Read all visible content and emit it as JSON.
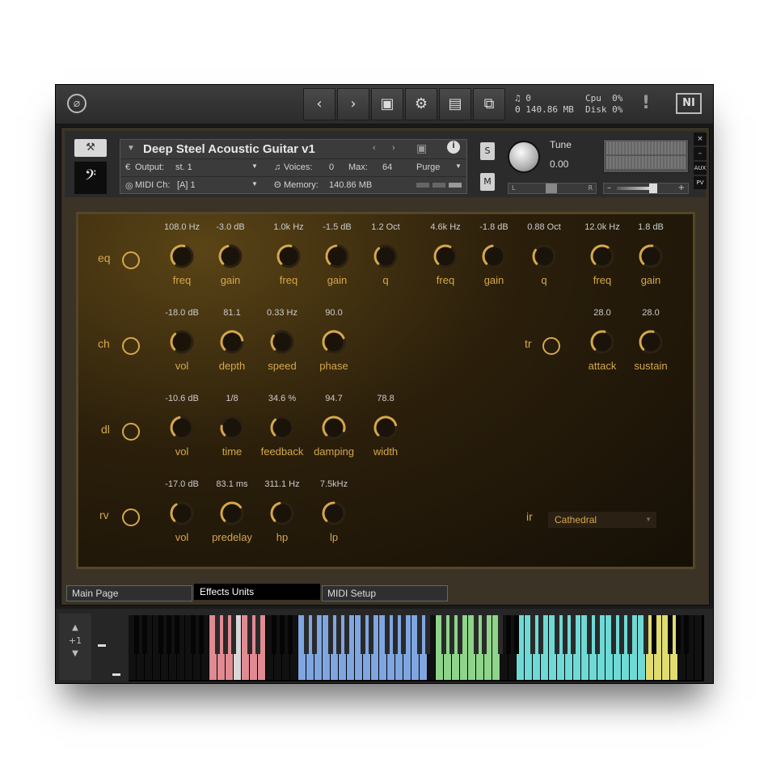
{
  "toolbar": {
    "stats_voices": "♫ 0",
    "stats_memory": "Θ 140.86 MB",
    "cpu_label": "Cpu",
    "cpu_value": "0%",
    "disk_label": "Disk",
    "disk_value": "0%",
    "warn": "!",
    "ni_logo": "NI"
  },
  "header": {
    "instrument_name": "Deep Steel Acoustic Guitar v1",
    "output_label": "Output:",
    "output_value": "st. 1",
    "voices_label": "Voices:",
    "voices_value": "0",
    "max_label": "Max:",
    "max_value": "64",
    "purge_label": "Purge",
    "midi_label": "MIDI Ch:",
    "midi_value": "[A]  1",
    "memory_label": "Memory:",
    "memory_value": "140.86 MB",
    "solo": "S",
    "mute": "M",
    "tune_label": "Tune",
    "tune_value": "0.00",
    "pan_left": "L",
    "pan_right": "R",
    "aux": "AUX",
    "pv": "PV",
    "close": "×",
    "minimize": "–"
  },
  "effects": {
    "eq": {
      "label": "eq",
      "knobs": [
        {
          "label": "freq",
          "value": "108.0 Hz",
          "level": 0.55
        },
        {
          "label": "gain",
          "value": "-3.0 dB",
          "level": 0.45
        },
        {
          "label": "freq",
          "value": "1.0k Hz",
          "level": 0.55
        },
        {
          "label": "gain",
          "value": "-1.5 dB",
          "level": 0.48
        },
        {
          "label": "q",
          "value": "1.2 Oct",
          "level": 0.35
        },
        {
          "label": "freq",
          "value": "4.6k Hz",
          "level": 0.6
        },
        {
          "label": "gain",
          "value": "-1.8 dB",
          "level": 0.47
        },
        {
          "label": "q",
          "value": "0.88 Oct",
          "level": 0.3
        },
        {
          "label": "freq",
          "value": "12.0k Hz",
          "level": 0.62
        },
        {
          "label": "gain",
          "value": "1.8 dB",
          "level": 0.53
        }
      ]
    },
    "ch": {
      "label": "ch",
      "knobs": [
        {
          "label": "vol",
          "value": "-18.0 dB",
          "level": 0.35
        },
        {
          "label": "depth",
          "value": "81.1",
          "level": 0.8
        },
        {
          "label": "speed",
          "value": "0.33 Hz",
          "level": 0.3
        },
        {
          "label": "phase",
          "value": "90.0",
          "level": 0.75
        }
      ]
    },
    "tr": {
      "label": "tr",
      "knobs": [
        {
          "label": "attack",
          "value": "28.0",
          "level": 0.55
        },
        {
          "label": "sustain",
          "value": "28.0",
          "level": 0.55
        }
      ]
    },
    "dl": {
      "label": "dl",
      "knobs": [
        {
          "label": "vol",
          "value": "-10.6 dB",
          "level": 0.45
        },
        {
          "label": "time",
          "value": "1/8",
          "level": 0.2
        },
        {
          "label": "feedback",
          "value": "34.6 %",
          "level": 0.35
        },
        {
          "label": "damping",
          "value": "94.7",
          "level": 0.9
        },
        {
          "label": "width",
          "value": "78.8",
          "level": 0.78
        }
      ]
    },
    "rv": {
      "label": "rv",
      "knobs": [
        {
          "label": "vol",
          "value": "-17.0 dB",
          "level": 0.38
        },
        {
          "label": "predelay",
          "value": "83.1 ms",
          "level": 0.7
        },
        {
          "label": "hp",
          "value": "311.1 Hz",
          "level": 0.45
        },
        {
          "label": "lp",
          "value": "7.5kHz",
          "level": 0.5
        }
      ],
      "ir_label": "ir",
      "ir_value": "Cathedral"
    }
  },
  "tabs": [
    "Main Page",
    "Effects Units",
    "MIDI Setup"
  ],
  "active_tab": "Effects Units",
  "keyboard": {
    "octave": "+1",
    "key_colors": {
      "red": "#e08a92",
      "blue": "#7fa6e0",
      "green": "#8ed48a",
      "cyan": "#6fd9d6",
      "yellow": "#e0dc70"
    },
    "accent": "#d6a74a"
  }
}
